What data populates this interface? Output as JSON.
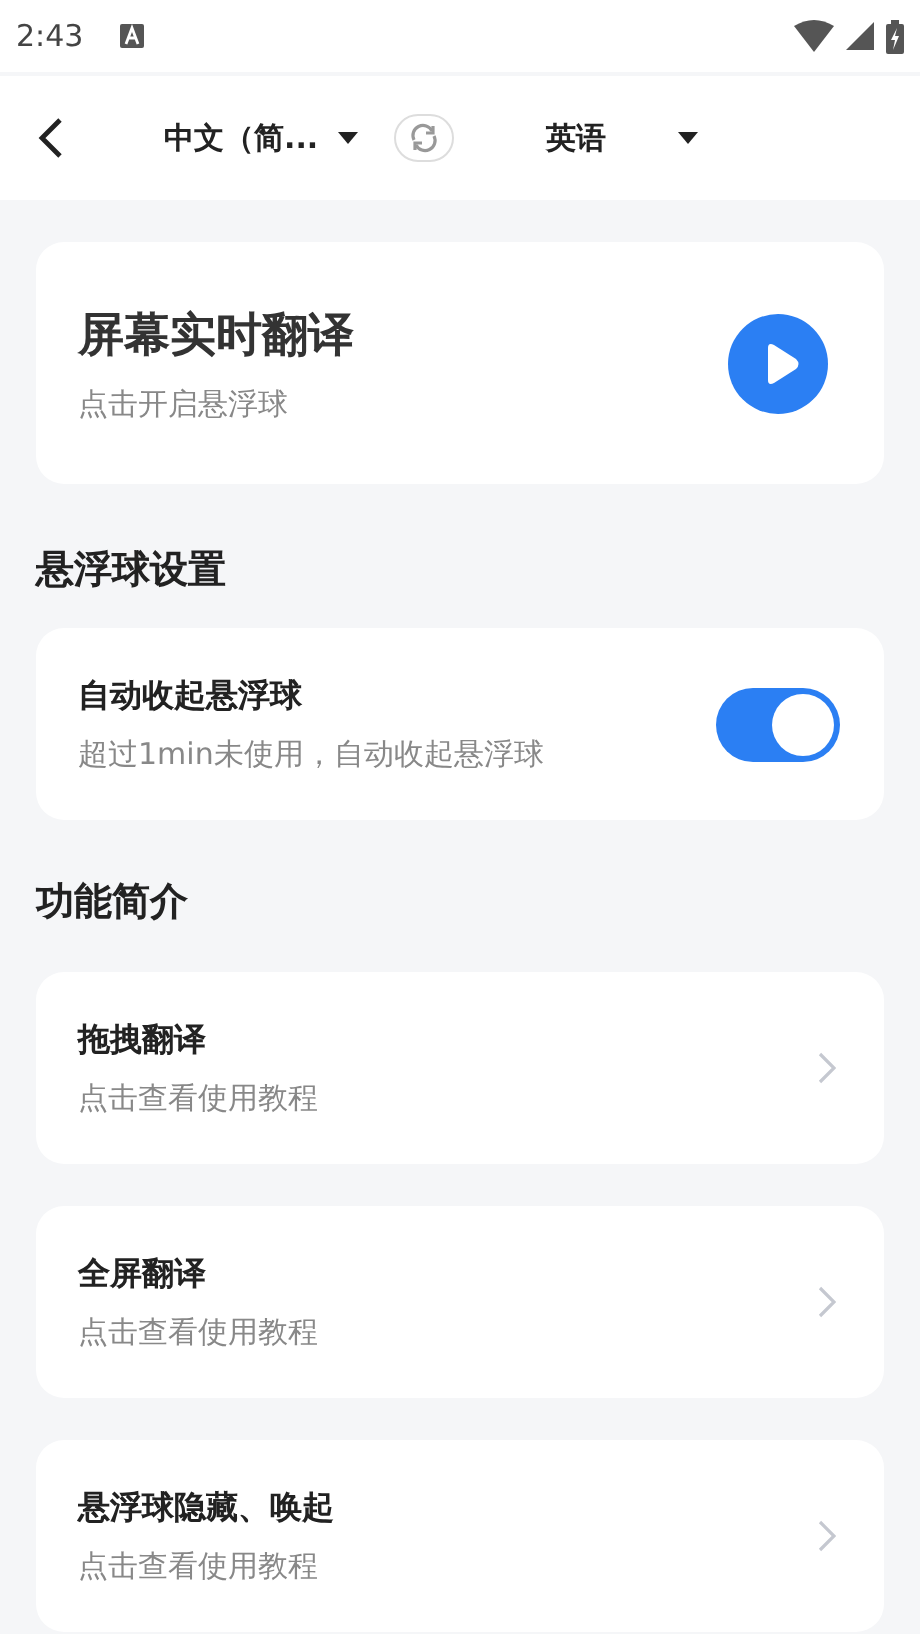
{
  "status_bar": {
    "time": "2:43"
  },
  "nav": {
    "source_language": "中文（简...",
    "target_language": "英语"
  },
  "hero": {
    "title": "屏幕实时翻译",
    "subtitle": "点击开启悬浮球"
  },
  "float_settings": {
    "heading": "悬浮球设置",
    "items": [
      {
        "title": "自动收起悬浮球",
        "subtitle": "超过1min未使用，自动收起悬浮球",
        "on": true
      }
    ]
  },
  "features": {
    "heading": "功能简介",
    "items": [
      {
        "title": "拖拽翻译",
        "subtitle": "点击查看使用教程"
      },
      {
        "title": "全屏翻译",
        "subtitle": "点击查看使用教程"
      },
      {
        "title": "悬浮球隐藏、唤起",
        "subtitle": "点击查看使用教程"
      }
    ]
  }
}
